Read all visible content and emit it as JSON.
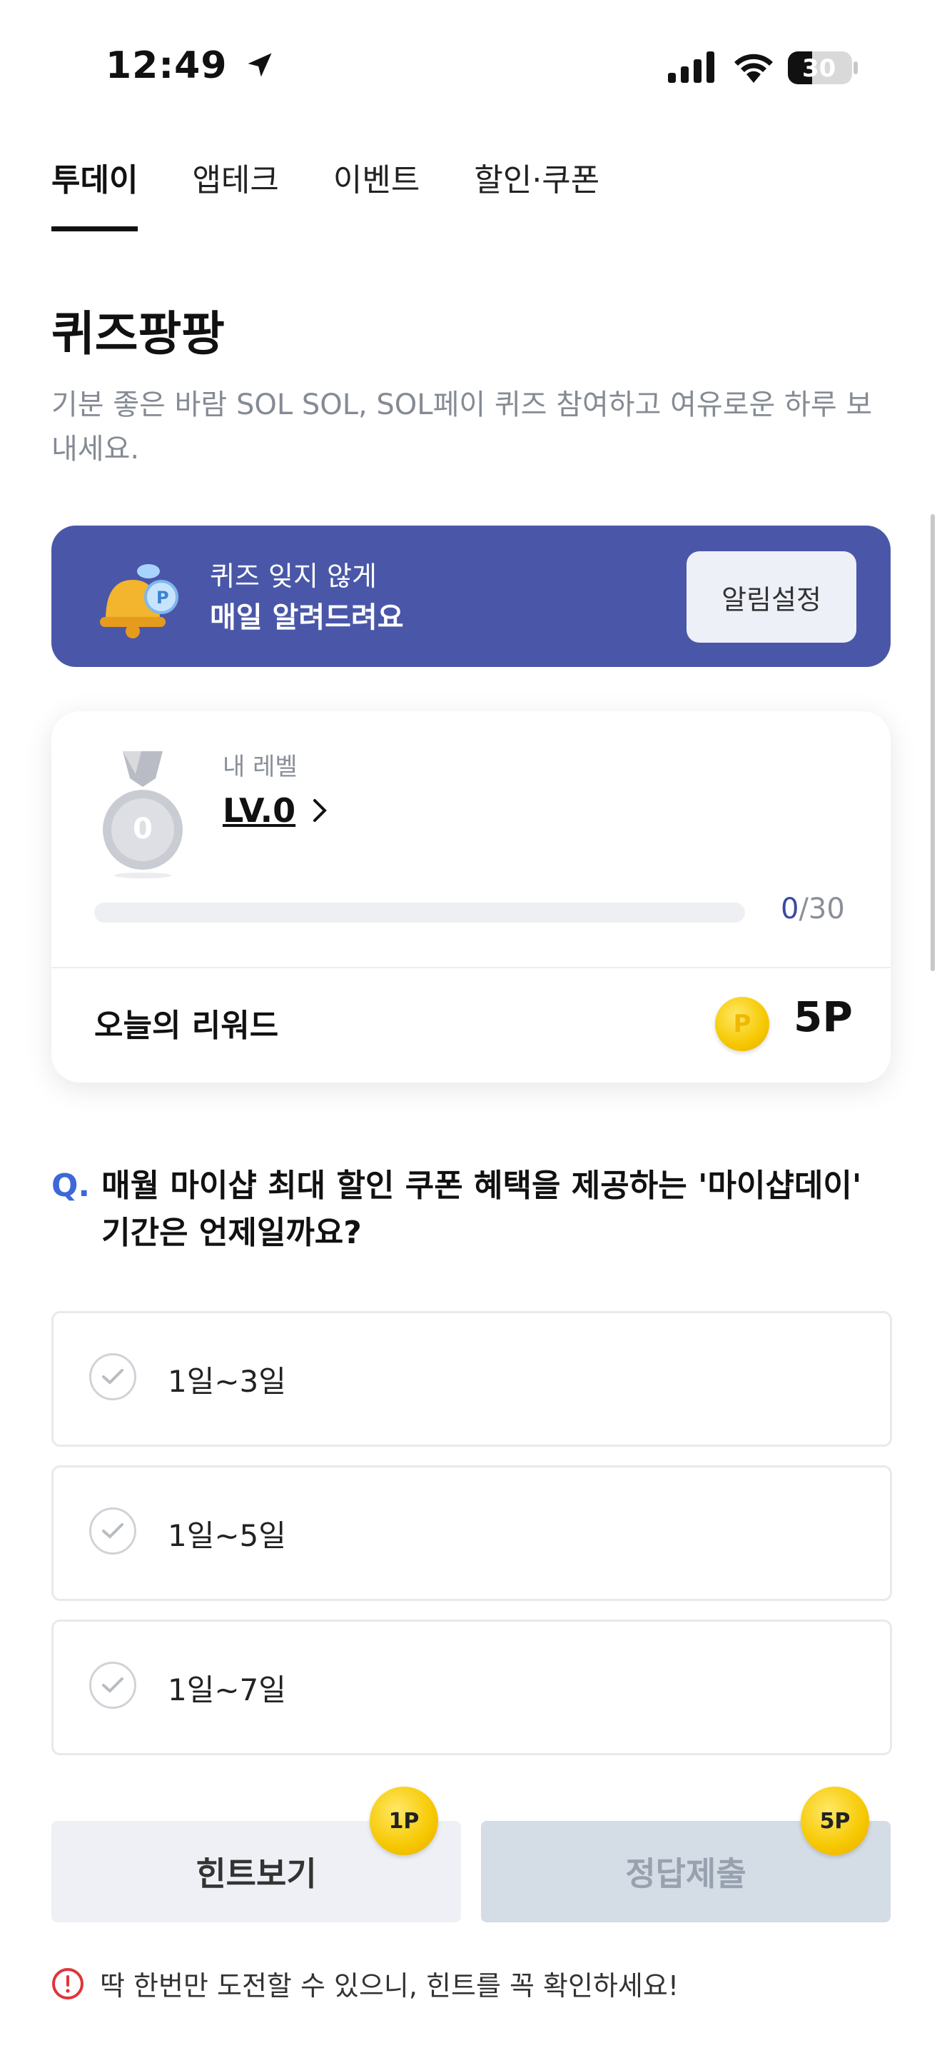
{
  "status_bar": {
    "time": "12:49",
    "battery": "30"
  },
  "tabs": [
    {
      "label": "투데이",
      "active": true
    },
    {
      "label": "앱테크",
      "active": false
    },
    {
      "label": "이벤트",
      "active": false
    },
    {
      "label": "할인·쿠폰",
      "active": false
    }
  ],
  "page": {
    "title": "퀴즈팡팡",
    "description": "기분 좋은 바람 SOL SOL, SOL페이 퀴즈 참여하고 여유로운 하루 보내세요."
  },
  "banner": {
    "line1": "퀴즈 잊지 않게",
    "line2": "매일 알려드려요",
    "button": "알림설정",
    "bg_color": "#4a57a8"
  },
  "level_card": {
    "medal_number": "0",
    "caption": "내 레벨",
    "level": "LV.0",
    "progress_current": "0",
    "progress_total": "/30",
    "progress_fraction": 0,
    "reward_label": "오늘의 리워드",
    "reward_value": "5P"
  },
  "quiz": {
    "prefix": "Q.",
    "question": "매월 마이샵 최대 할인 쿠폰 혜택을 제공하는 '마이샵데이' 기간은 언제일까요?",
    "options": [
      "1일~3일",
      "1일~5일",
      "1일~7일"
    ]
  },
  "actions": {
    "hint_label": "힌트보기",
    "hint_cost": "1P",
    "submit_label": "정답제출",
    "submit_reward": "5P"
  },
  "notice": "딱 한번만 도전할 수 있으니, 힌트를 꼭 확인하세요!"
}
